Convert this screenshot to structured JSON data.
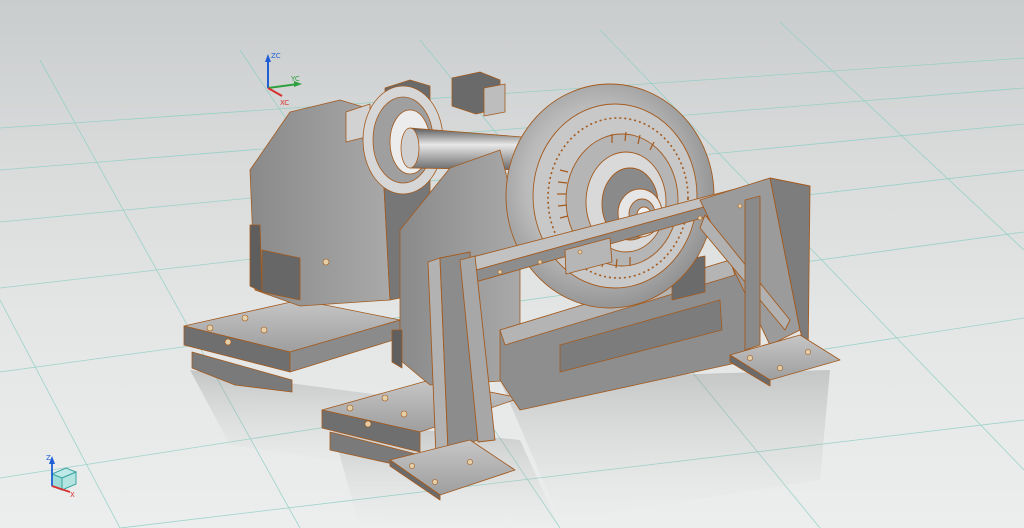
{
  "viewport": {
    "model_name": "",
    "background_top": "#c9cccd",
    "background_bottom": "#eceeee",
    "grid_color": "#8fcfc3",
    "edge_color": "#a35a1e",
    "body_color": "#9c9c9c"
  },
  "wcs_triad": {
    "z_label": "ZC",
    "y_label": "YC",
    "x_label": "XC",
    "z_color": "#1f5fd6",
    "y_color": "#2fa040",
    "x_color": "#d83030"
  },
  "view_triad": {
    "z_label": "Z",
    "x_label": "X",
    "icon": "view-cube-icon"
  }
}
